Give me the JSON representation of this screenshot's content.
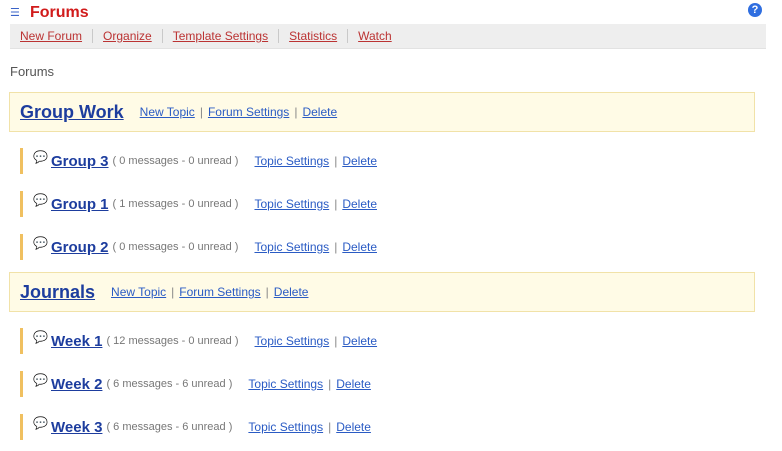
{
  "header": {
    "title": "Forums",
    "title_icon": "forum-icon",
    "help_icon": "help-icon"
  },
  "toolbar": {
    "items": [
      "New Forum",
      "Organize",
      "Template Settings",
      "Statistics",
      "Watch"
    ]
  },
  "section_label": "Forums",
  "forums": [
    {
      "title": "Group Work",
      "links": [
        "New Topic",
        "Forum Settings",
        "Delete"
      ],
      "topics": [
        {
          "title": "Group 3",
          "stats": "( 0 messages - 0 unread )",
          "links": [
            "Topic Settings",
            "Delete"
          ]
        },
        {
          "title": "Group 1",
          "stats": "( 1 messages - 0 unread )",
          "links": [
            "Topic Settings",
            "Delete"
          ]
        },
        {
          "title": "Group 2",
          "stats": "( 0 messages - 0 unread )",
          "links": [
            "Topic Settings",
            "Delete"
          ]
        }
      ]
    },
    {
      "title": "Journals",
      "links": [
        "New Topic",
        "Forum Settings",
        "Delete"
      ],
      "topics": [
        {
          "title": "Week 1",
          "stats": "( 12 messages - 0 unread )",
          "links": [
            "Topic Settings",
            "Delete"
          ]
        },
        {
          "title": "Week 2",
          "stats": "( 6 messages - 6 unread )",
          "links": [
            "Topic Settings",
            "Delete"
          ]
        },
        {
          "title": "Week 3",
          "stats": "( 6 messages - 6 unread )",
          "links": [
            "Topic Settings",
            "Delete"
          ]
        }
      ]
    }
  ]
}
